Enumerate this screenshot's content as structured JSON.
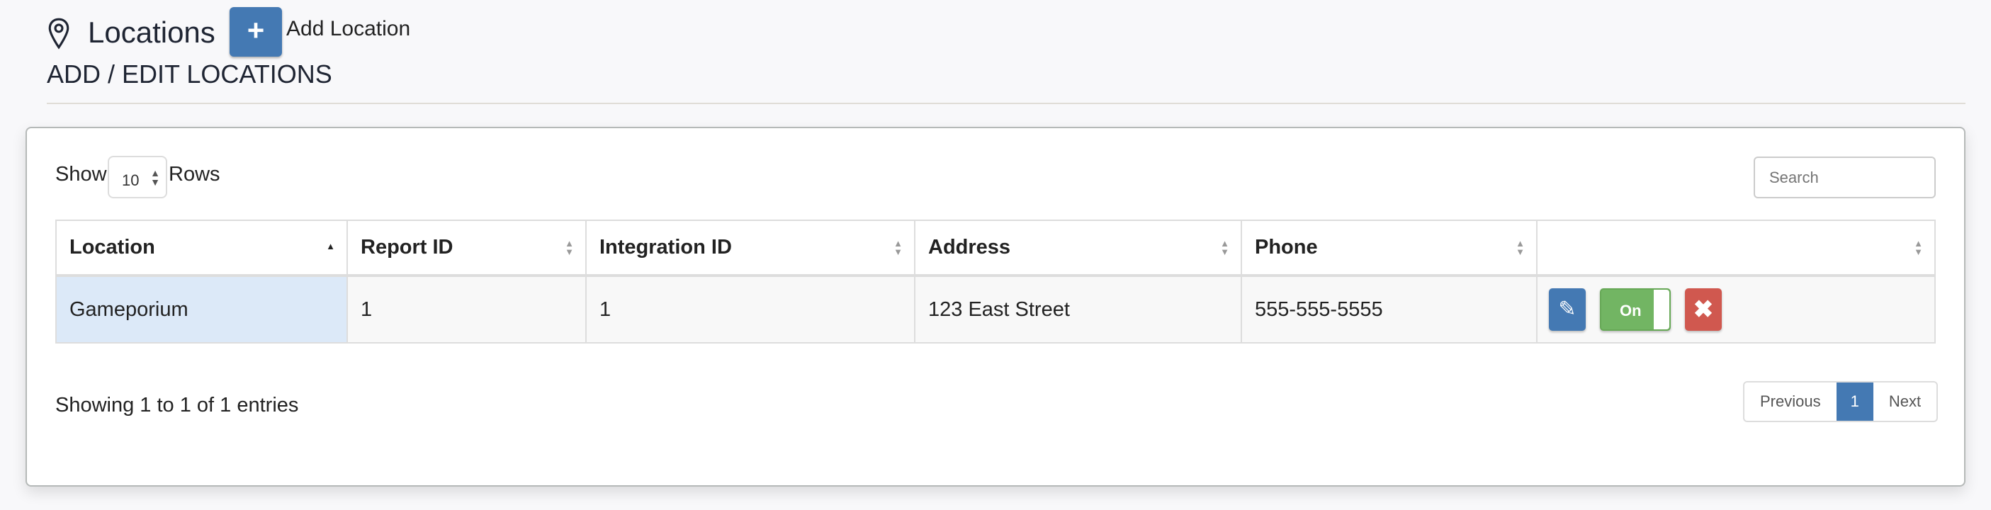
{
  "header": {
    "title": "Locations",
    "add_label": "Add Location",
    "add_icon": "plus-icon",
    "subtitle": "ADD / EDIT LOCATIONS",
    "title_icon": "map-pin-icon"
  },
  "controls": {
    "show_label": "Show",
    "rows_value": "10",
    "rows_label": "Rows",
    "search_placeholder": "Search"
  },
  "table": {
    "columns": [
      "Location",
      "Report ID",
      "Integration ID",
      "Address",
      "Phone",
      ""
    ],
    "sorted_column": "Location",
    "sort_direction": "ascending",
    "rows": [
      {
        "location": "Gameporium",
        "report_id": "1",
        "integration_id": "1",
        "address": "123 East Street",
        "phone": "555-555-5555",
        "toggle": "On"
      }
    ]
  },
  "footer": {
    "info": "Showing 1 to 1 of 1 entries",
    "previous": "Previous",
    "current_page": "1",
    "next": "Next"
  },
  "colors": {
    "primary": "#4479b3",
    "success": "#72b563",
    "danger": "#d0584f",
    "selected_cell": "#dce9f8"
  }
}
